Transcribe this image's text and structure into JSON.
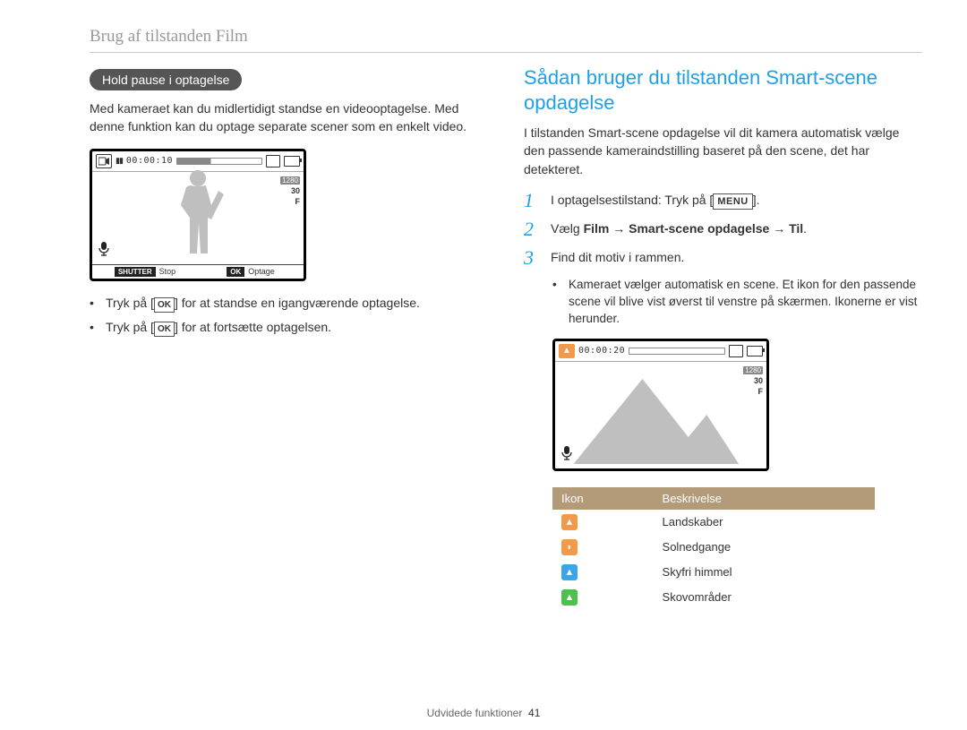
{
  "header": "Brug af tilstanden Film",
  "left": {
    "pill": "Hold pause i optagelse",
    "para": "Med kameraet kan du midlertidigt standse en videooptagelse. Med denne funktion kan du optage separate scener som en enkelt video.",
    "lcd": {
      "pause_glyph": "▮▮",
      "time": "00:00:10",
      "side1": "1280",
      "side2": "30",
      "side3": "F",
      "btn_shutter": "SHUTTER",
      "btn_stop": "Stop",
      "btn_ok": "OK",
      "btn_rec": "Optage"
    },
    "bullets": [
      {
        "pre": "Tryk på [",
        "btn": "OK",
        "post": "] for at standse en igangværende optagelse."
      },
      {
        "pre": "Tryk på [",
        "btn": "OK",
        "post": "] for at fortsætte optagelsen."
      }
    ]
  },
  "right": {
    "h2": "Sådan bruger du tilstanden Smart-scene opdagelse",
    "intro": "I tilstanden Smart-scene opdagelse vil dit kamera automatisk vælge den passende kameraindstilling baseret på den scene, det har detekteret.",
    "steps": [
      {
        "pre": "I optagelsestilstand: Tryk på [",
        "btn": "MENU",
        "post": "]."
      },
      {
        "text_parts": [
          "Vælg ",
          "Film",
          " → ",
          "Smart-scene opdagelse",
          " → ",
          "Til",
          "."
        ]
      },
      {
        "plain": "Find dit motiv i rammen."
      }
    ],
    "sub": "Kameraet vælger automatisk en scene. Et ikon for den passende scene vil blive vist øverst til venstre på skærmen. Ikonerne er vist herunder.",
    "lcd": {
      "mount_glyph": "▲",
      "time": "00:00:20",
      "side1": "1280",
      "side2": "30",
      "side3": "F"
    },
    "table": {
      "head_icon": "Ikon",
      "head_desc": "Beskrivelse",
      "rows": [
        {
          "glyph": "▲",
          "cls": "ic-orange",
          "label": "Landskaber"
        },
        {
          "glyph": "◗",
          "cls": "ic-orange",
          "label": "Solnedgange"
        },
        {
          "glyph": "▲",
          "cls": "ic-blue",
          "label": "Skyfri himmel"
        },
        {
          "glyph": "▲",
          "cls": "ic-green",
          "label": "Skovområder"
        }
      ]
    }
  },
  "footer": {
    "section": "Udvidede funktioner",
    "page": "41"
  }
}
